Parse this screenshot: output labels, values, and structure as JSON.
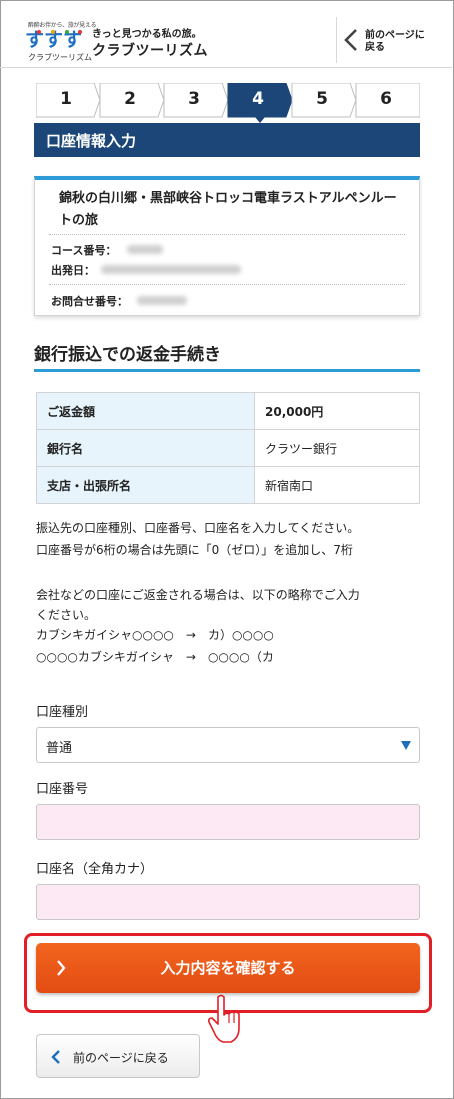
{
  "header": {
    "logo_tagline": "酔酔お伴から、旅が見える",
    "logo_mark_text": "すすすす",
    "logo_sub": "クラブツーリズム",
    "catchphrase": "きっと見つかる私の旅。",
    "brand_name": "クラブツーリズム",
    "back_label_line1": "前のページに",
    "back_label_line2": "戻る"
  },
  "steps": {
    "items": [
      "1",
      "2",
      "3",
      "4",
      "5",
      "6"
    ],
    "current_index": 3
  },
  "section_bar_title": "口座情報入力",
  "tour_card": {
    "tour_name": "錦秋の白川郷・黒部峡谷トロッコ電車ラストアルペンルートの旅",
    "course_label": "コース番号：",
    "departure_label": "出発日：",
    "inquiry_label": "お問合せ番号："
  },
  "refund_section_title": "銀行振込での返金手続き",
  "refund_table": [
    {
      "label": "ご返金額",
      "value": "20,000円",
      "bold": true
    },
    {
      "label": "銀行名",
      "value": "クラツー銀行",
      "bold": false
    },
    {
      "label": "支店・出張所名",
      "value": "新宿南口",
      "bold": false
    }
  ],
  "instructions": {
    "line1": "振込先の口座種別、口座番号、口座名を入力してください。",
    "line2": "口座番号が6桁の場合は先頭に「0（ゼロ）」を追加し、7桁",
    "corp_line1": "会社などの口座にご返金される場合は、以下の略称でご入力",
    "corp_line2": "ください。",
    "corp_line3": "カブシキガイシャ○○○○　→　カ）○○○○",
    "corp_line4": "○○○○カブシキガイシャ　→　○○○○（カ"
  },
  "form": {
    "account_type_label": "口座種別",
    "account_type_value": "普通",
    "account_number_label": "口座番号",
    "account_name_label": "口座名（全角カナ）"
  },
  "confirm_button_label": "入力内容を確認する",
  "back_button_label": "前のページに戻る",
  "colors": {
    "navy": "#1b4677",
    "accent_blue": "#2d9bd5",
    "orange": "#e95a17",
    "highlight_red": "#e21f26",
    "input_pink": "#fde9f3"
  }
}
